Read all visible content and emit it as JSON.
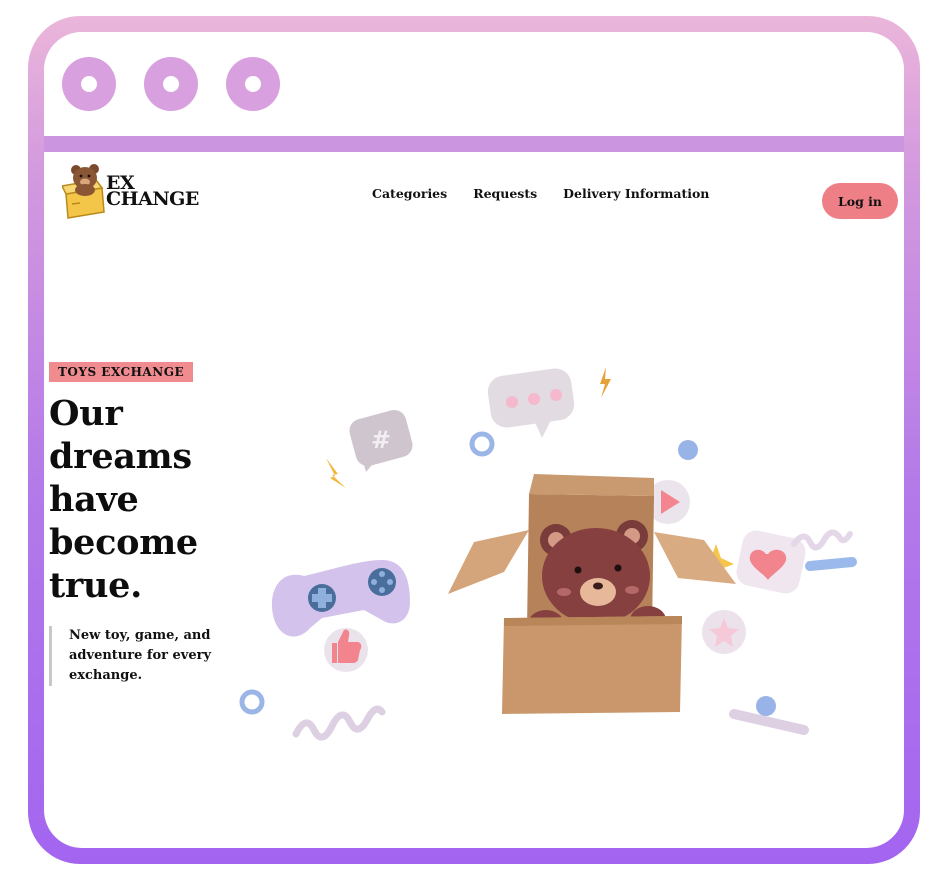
{
  "window": {
    "dots": [
      "window-dot-1",
      "window-dot-2",
      "window-dot-3"
    ]
  },
  "brand": {
    "line1": "EX",
    "line2": "CHANGE"
  },
  "nav": {
    "items": [
      "Categories",
      "Requests",
      "Delivery Information"
    ],
    "login_label": "Log in"
  },
  "hero": {
    "badge": "TOYS EXCHANGE",
    "headline": [
      "Our",
      "dreams",
      "have",
      "become",
      "true."
    ],
    "tagline": [
      "New toy, game, and",
      "adventure for every",
      "exchange."
    ]
  },
  "colors": {
    "frame_gradient_top": "#ebb6da",
    "frame_gradient_bottom": "#a365f0",
    "accent_pink": "#ef7f86",
    "box_brown": "#c9976b",
    "bear_brown": "#7a3b3b"
  },
  "illustration": {
    "icons": [
      "bear-in-box",
      "game-controller-icon",
      "hashtag-chat-icon",
      "chat-bubble-icon",
      "play-button-icon",
      "heart-chat-icon",
      "star-badge-icon",
      "thumbs-up-icon",
      "lightning-icon",
      "sparkle-icon"
    ]
  }
}
